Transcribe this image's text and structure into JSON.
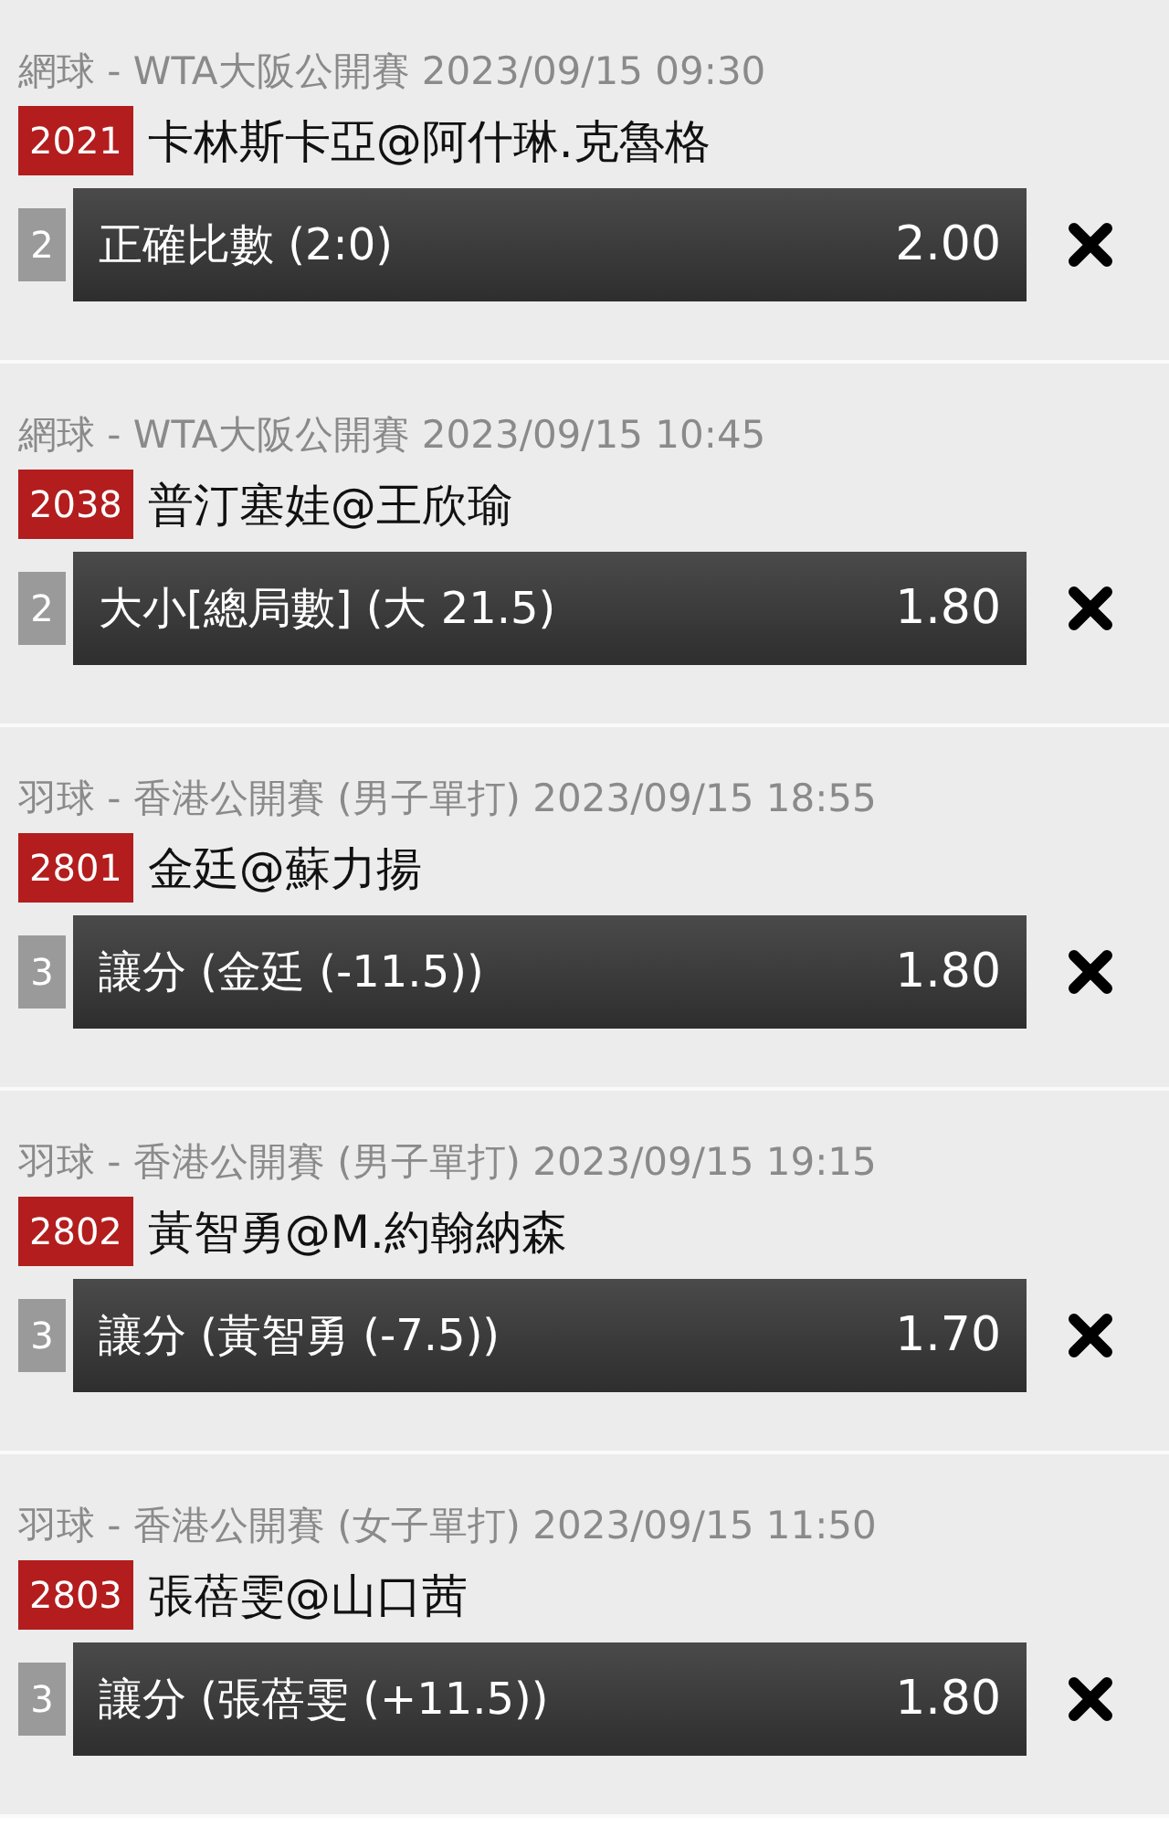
{
  "bets": [
    {
      "header": "網球 - WTA大阪公開賽 2023/09/15 09:30",
      "code": "2021",
      "match": "卡林斯卡亞@阿什琳.克魯格",
      "leg": "2",
      "selection": "正確比數 (2:0)",
      "odds": "2.00"
    },
    {
      "header": "網球 - WTA大阪公開賽 2023/09/15 10:45",
      "code": "2038",
      "match": "普汀塞娃@王欣瑜",
      "leg": "2",
      "selection": "大小[總局數] (大 21.5)",
      "odds": "1.80"
    },
    {
      "header": "羽球 - 香港公開賽 (男子單打) 2023/09/15 18:55",
      "code": "2801",
      "match": "金廷@蘇力揚",
      "leg": "3",
      "selection": "讓分 (金廷 (-11.5))",
      "odds": "1.80"
    },
    {
      "header": "羽球 - 香港公開賽 (男子單打) 2023/09/15 19:15",
      "code": "2802",
      "match": "黃智勇@M.約翰納森",
      "leg": "3",
      "selection": "讓分 (黃智勇 (-7.5))",
      "odds": "1.70"
    },
    {
      "header": "羽球 - 香港公開賽 (女子單打) 2023/09/15 11:50",
      "code": "2803",
      "match": "張蓓雯@山口茜",
      "leg": "3",
      "selection": "讓分 (張蓓雯 (+11.5))",
      "odds": "1.80"
    }
  ]
}
